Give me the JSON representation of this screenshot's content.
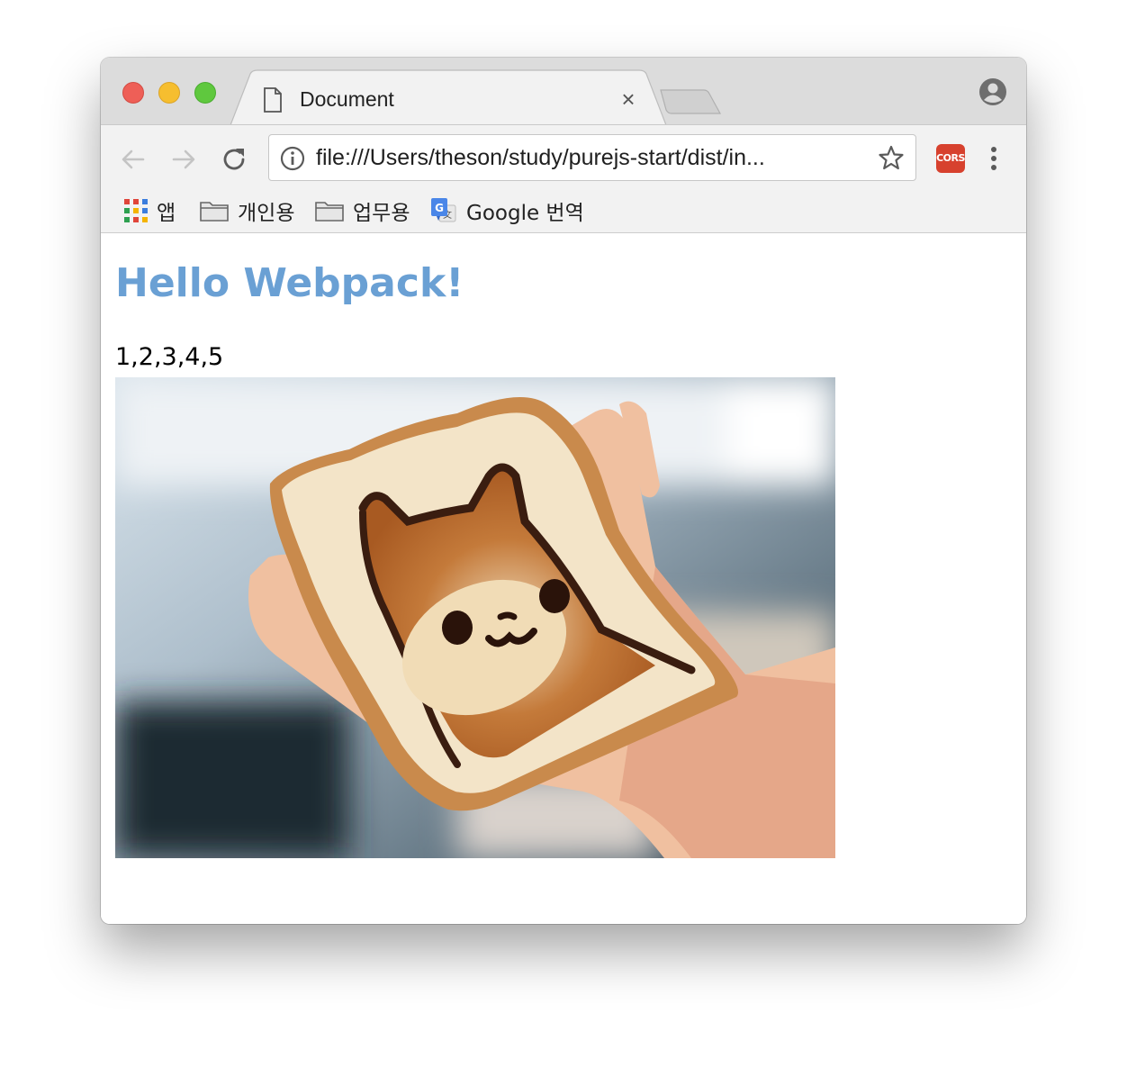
{
  "tab": {
    "title": "Document",
    "close": "×"
  },
  "omnibox": {
    "url": "file:///Users/theson/study/purejs-start/dist/in..."
  },
  "extension": {
    "label": "CORS",
    "color": "#d7412e"
  },
  "bookmarks": [
    {
      "label": "앱",
      "icon": "apps-grid-icon"
    },
    {
      "label": "개인용",
      "icon": "folder-icon"
    },
    {
      "label": "업무용",
      "icon": "folder-icon"
    },
    {
      "label": "Google 번역",
      "icon": "google-translate-icon"
    }
  ],
  "page": {
    "title": "Hello Webpack!",
    "title_color": "#6aa0d4",
    "numbers": "1,2,3,4,5",
    "image": "photo of a hand holding a toast slice with a shiba dog face"
  }
}
